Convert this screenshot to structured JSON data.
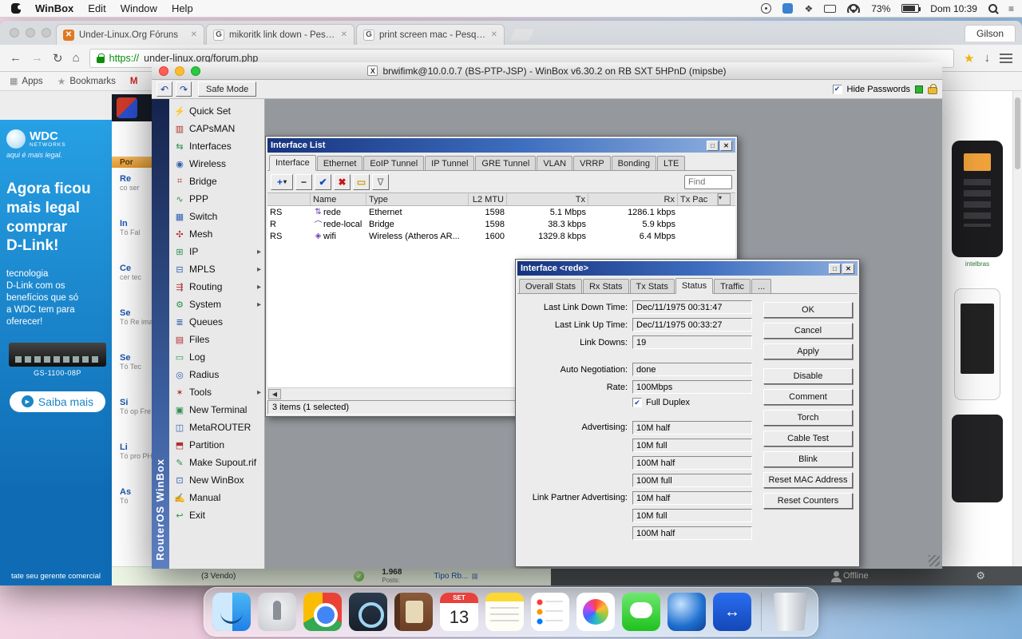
{
  "menubar": {
    "app_name": "WinBox",
    "menus": [
      "Edit",
      "Window",
      "Help"
    ],
    "battery_pct": "73%",
    "clock": "Dom 10:39"
  },
  "icons": {
    "undo": "↶",
    "redo": "↷",
    "back": "←",
    "forward": "→",
    "reload": "↻",
    "home": "⌂",
    "star": "★",
    "download": "↓",
    "apps_grid": "▦",
    "bookmark_star": "★",
    "add": "+",
    "add_caret": "▾",
    "remove": "−",
    "enable": "✔",
    "disable": "✖",
    "comment": "▭",
    "filter": "∇",
    "win_max": "□",
    "win_close": "✕",
    "check": "✔",
    "gear": "⚙",
    "play": "▶",
    "col_caret": "▾",
    "scroll_left": "◀",
    "topic_grid": "▦",
    "arrows_h": "↔",
    "ok_check": "✔"
  },
  "chrome": {
    "profile": "Gilson",
    "tabs": [
      {
        "title": "Under-Linux.Org Fóruns",
        "favicon": "✕"
      },
      {
        "title": "mikoritk link down - Pesquis",
        "favicon": "G"
      },
      {
        "title": "print screen mac - Pesquisa",
        "favicon": "G"
      }
    ],
    "url_scheme": "https://",
    "url_rest": "under-linux.org/forum.php",
    "bookmarks_apps": "Apps",
    "bookmarks_label": "Bookmarks",
    "bookmark_item": "M"
  },
  "page": {
    "forum_header": "Por",
    "forum_items": [
      {
        "t": "Re",
        "s": "co ser"
      },
      {
        "t": "In",
        "s": "Tó Fal"
      },
      {
        "t": "Ce",
        "s": "cer tec"
      },
      {
        "t": "Se",
        "s": "Tó Re ima"
      },
      {
        "t": "Se",
        "s": "Tó Tec"
      },
      {
        "t": "Si",
        "s": "Tó op Fre"
      },
      {
        "t": "Li",
        "s": "Tó pro PH"
      },
      {
        "t": "As",
        "s": "Tó"
      }
    ],
    "ad": {
      "brand": "WDC",
      "brand_sub": "NETWORKS",
      "tagline": "aqui é mais legal.",
      "headline": [
        "Agora ficou",
        "mais legal",
        "comprar",
        "D-Link!"
      ],
      "body": [
        "tecnologia",
        "D-Link com os",
        "benefícios que só",
        "a WDC tem para",
        "oferecer!"
      ],
      "product": "GS-1100-08P",
      "cta": "Saiba mais",
      "footer": "tate seu gerente comercial"
    },
    "footer_row": {
      "vendo": "(3 Vendo)",
      "count": "1.968",
      "posts": "Posts:",
      "topic": "Tipo Rb...",
      "offline": "Offline"
    },
    "phone_brand": "intelbras"
  },
  "winbox": {
    "title": "brwifimk@10.0.0.7 (BS-PTP-JSP) - WinBox v6.30.2 on RB SXT 5HPnD (mipsbe)",
    "app_icon_glyph": "X",
    "safe_mode": "Safe Mode",
    "hide_passwords": "Hide Passwords",
    "brand_vertical": "RouterOS WinBox",
    "sidebar": [
      {
        "label": "Quick Set",
        "icon": "⚡",
        "arrow": ""
      },
      {
        "label": "CAPsMAN",
        "icon": "▥",
        "arrow": ""
      },
      {
        "label": "Interfaces",
        "icon": "⇆",
        "arrow": ""
      },
      {
        "label": "Wireless",
        "icon": "◉",
        "arrow": ""
      },
      {
        "label": "Bridge",
        "icon": "⌗",
        "arrow": ""
      },
      {
        "label": "PPP",
        "icon": "∿",
        "arrow": ""
      },
      {
        "label": "Switch",
        "icon": "▦",
        "arrow": ""
      },
      {
        "label": "Mesh",
        "icon": "✣",
        "arrow": ""
      },
      {
        "label": "IP",
        "icon": "⊞",
        "arrow": "▸"
      },
      {
        "label": "MPLS",
        "icon": "⊟",
        "arrow": "▸"
      },
      {
        "label": "Routing",
        "icon": "⇶",
        "arrow": "▸"
      },
      {
        "label": "System",
        "icon": "⚙",
        "arrow": "▸"
      },
      {
        "label": "Queues",
        "icon": "≣",
        "arrow": ""
      },
      {
        "label": "Files",
        "icon": "▤",
        "arrow": ""
      },
      {
        "label": "Log",
        "icon": "▭",
        "arrow": ""
      },
      {
        "label": "Radius",
        "icon": "◎",
        "arrow": ""
      },
      {
        "label": "Tools",
        "icon": "✶",
        "arrow": "▸"
      },
      {
        "label": "New Terminal",
        "icon": "▣",
        "arrow": ""
      },
      {
        "label": "MetaROUTER",
        "icon": "◫",
        "arrow": ""
      },
      {
        "label": "Partition",
        "icon": "⬒",
        "arrow": ""
      },
      {
        "label": "Make Supout.rif",
        "icon": "✎",
        "arrow": ""
      },
      {
        "label": "New WinBox",
        "icon": "⊡",
        "arrow": ""
      },
      {
        "label": "Manual",
        "icon": "✍",
        "arrow": ""
      },
      {
        "label": "Exit",
        "icon": "↩",
        "arrow": ""
      }
    ]
  },
  "interface_list": {
    "title": "Interface List",
    "tabs": [
      "Interface",
      "Ethernet",
      "EoIP Tunnel",
      "IP Tunnel",
      "GRE Tunnel",
      "VLAN",
      "VRRP",
      "Bonding",
      "LTE"
    ],
    "active_tab": "Interface",
    "find_placeholder": "Find",
    "columns": [
      "Name",
      "Type",
      "L2 MTU",
      "Tx",
      "Rx",
      "Tx Pac"
    ],
    "rows": [
      {
        "flags": "RS",
        "icon": "⇅",
        "name": "rede",
        "type": "Ethernet",
        "l2mtu": "1598",
        "tx": "5.1 Mbps",
        "rx": "1286.1 kbps"
      },
      {
        "flags": "R",
        "icon": "⌒",
        "name": "rede-local",
        "type": "Bridge",
        "l2mtu": "1598",
        "tx": "38.3 kbps",
        "rx": "5.9 kbps"
      },
      {
        "flags": "RS",
        "icon": "◈",
        "name": "wifi",
        "type": "Wireless (Atheros AR...",
        "l2mtu": "1600",
        "tx": "1329.8 kbps",
        "rx": "6.4 Mbps"
      }
    ],
    "status": "3 items (1 selected)"
  },
  "dialog": {
    "title": "Interface <rede>",
    "tabs": [
      "Overall Stats",
      "Rx Stats",
      "Tx Stats",
      "Status",
      "Traffic",
      "..."
    ],
    "active_tab": "Status",
    "fields": [
      {
        "label": "Last Link Down Time:",
        "value": "Dec/11/1975 00:31:47"
      },
      {
        "label": "Last Link Up Time:",
        "value": "Dec/11/1975 00:33:27"
      },
      {
        "label": "Link Downs:",
        "value": "19"
      }
    ],
    "fields2": [
      {
        "label": "Auto Negotiation:",
        "value": "done"
      },
      {
        "label": "Rate:",
        "value": "100Mbps"
      }
    ],
    "full_duplex": "Full Duplex",
    "advertising_label": "Advertising:",
    "advertising": [
      "10M half",
      "10M full",
      "100M half",
      "100M full"
    ],
    "partner_label": "Link Partner Advertising:",
    "partner": [
      "10M half",
      "10M full",
      "100M half"
    ],
    "buttons_main": [
      "OK",
      "Cancel",
      "Apply"
    ],
    "buttons_side": [
      "Disable",
      "Comment",
      "Torch",
      "Cable Test",
      "Blink",
      "Reset MAC Address",
      "Reset Counters"
    ]
  },
  "dock": {
    "items": [
      "finder",
      "launchpad",
      "chrome",
      "preview",
      "contacts",
      "calendar",
      "notes",
      "reminders",
      "photos",
      "messages",
      "winbox-sphere",
      "teamviewer",
      "trash"
    ],
    "calendar_day": "13",
    "calendar_month": "SET"
  }
}
